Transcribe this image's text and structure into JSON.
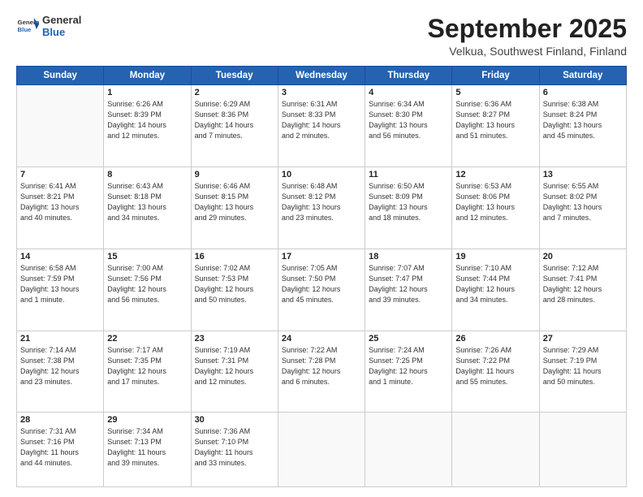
{
  "header": {
    "logo_general": "General",
    "logo_blue": "Blue",
    "month_title": "September 2025",
    "location": "Velkua, Southwest Finland, Finland"
  },
  "weekdays": [
    "Sunday",
    "Monday",
    "Tuesday",
    "Wednesday",
    "Thursday",
    "Friday",
    "Saturday"
  ],
  "weeks": [
    [
      {
        "day": "",
        "info": ""
      },
      {
        "day": "1",
        "info": "Sunrise: 6:26 AM\nSunset: 8:39 PM\nDaylight: 14 hours\nand 12 minutes."
      },
      {
        "day": "2",
        "info": "Sunrise: 6:29 AM\nSunset: 8:36 PM\nDaylight: 14 hours\nand 7 minutes."
      },
      {
        "day": "3",
        "info": "Sunrise: 6:31 AM\nSunset: 8:33 PM\nDaylight: 14 hours\nand 2 minutes."
      },
      {
        "day": "4",
        "info": "Sunrise: 6:34 AM\nSunset: 8:30 PM\nDaylight: 13 hours\nand 56 minutes."
      },
      {
        "day": "5",
        "info": "Sunrise: 6:36 AM\nSunset: 8:27 PM\nDaylight: 13 hours\nand 51 minutes."
      },
      {
        "day": "6",
        "info": "Sunrise: 6:38 AM\nSunset: 8:24 PM\nDaylight: 13 hours\nand 45 minutes."
      }
    ],
    [
      {
        "day": "7",
        "info": "Sunrise: 6:41 AM\nSunset: 8:21 PM\nDaylight: 13 hours\nand 40 minutes."
      },
      {
        "day": "8",
        "info": "Sunrise: 6:43 AM\nSunset: 8:18 PM\nDaylight: 13 hours\nand 34 minutes."
      },
      {
        "day": "9",
        "info": "Sunrise: 6:46 AM\nSunset: 8:15 PM\nDaylight: 13 hours\nand 29 minutes."
      },
      {
        "day": "10",
        "info": "Sunrise: 6:48 AM\nSunset: 8:12 PM\nDaylight: 13 hours\nand 23 minutes."
      },
      {
        "day": "11",
        "info": "Sunrise: 6:50 AM\nSunset: 8:09 PM\nDaylight: 13 hours\nand 18 minutes."
      },
      {
        "day": "12",
        "info": "Sunrise: 6:53 AM\nSunset: 8:06 PM\nDaylight: 13 hours\nand 12 minutes."
      },
      {
        "day": "13",
        "info": "Sunrise: 6:55 AM\nSunset: 8:02 PM\nDaylight: 13 hours\nand 7 minutes."
      }
    ],
    [
      {
        "day": "14",
        "info": "Sunrise: 6:58 AM\nSunset: 7:59 PM\nDaylight: 13 hours\nand 1 minute."
      },
      {
        "day": "15",
        "info": "Sunrise: 7:00 AM\nSunset: 7:56 PM\nDaylight: 12 hours\nand 56 minutes."
      },
      {
        "day": "16",
        "info": "Sunrise: 7:02 AM\nSunset: 7:53 PM\nDaylight: 12 hours\nand 50 minutes."
      },
      {
        "day": "17",
        "info": "Sunrise: 7:05 AM\nSunset: 7:50 PM\nDaylight: 12 hours\nand 45 minutes."
      },
      {
        "day": "18",
        "info": "Sunrise: 7:07 AM\nSunset: 7:47 PM\nDaylight: 12 hours\nand 39 minutes."
      },
      {
        "day": "19",
        "info": "Sunrise: 7:10 AM\nSunset: 7:44 PM\nDaylight: 12 hours\nand 34 minutes."
      },
      {
        "day": "20",
        "info": "Sunrise: 7:12 AM\nSunset: 7:41 PM\nDaylight: 12 hours\nand 28 minutes."
      }
    ],
    [
      {
        "day": "21",
        "info": "Sunrise: 7:14 AM\nSunset: 7:38 PM\nDaylight: 12 hours\nand 23 minutes."
      },
      {
        "day": "22",
        "info": "Sunrise: 7:17 AM\nSunset: 7:35 PM\nDaylight: 12 hours\nand 17 minutes."
      },
      {
        "day": "23",
        "info": "Sunrise: 7:19 AM\nSunset: 7:31 PM\nDaylight: 12 hours\nand 12 minutes."
      },
      {
        "day": "24",
        "info": "Sunrise: 7:22 AM\nSunset: 7:28 PM\nDaylight: 12 hours\nand 6 minutes."
      },
      {
        "day": "25",
        "info": "Sunrise: 7:24 AM\nSunset: 7:25 PM\nDaylight: 12 hours\nand 1 minute."
      },
      {
        "day": "26",
        "info": "Sunrise: 7:26 AM\nSunset: 7:22 PM\nDaylight: 11 hours\nand 55 minutes."
      },
      {
        "day": "27",
        "info": "Sunrise: 7:29 AM\nSunset: 7:19 PM\nDaylight: 11 hours\nand 50 minutes."
      }
    ],
    [
      {
        "day": "28",
        "info": "Sunrise: 7:31 AM\nSunset: 7:16 PM\nDaylight: 11 hours\nand 44 minutes."
      },
      {
        "day": "29",
        "info": "Sunrise: 7:34 AM\nSunset: 7:13 PM\nDaylight: 11 hours\nand 39 minutes."
      },
      {
        "day": "30",
        "info": "Sunrise: 7:36 AM\nSunset: 7:10 PM\nDaylight: 11 hours\nand 33 minutes."
      },
      {
        "day": "",
        "info": ""
      },
      {
        "day": "",
        "info": ""
      },
      {
        "day": "",
        "info": ""
      },
      {
        "day": "",
        "info": ""
      }
    ]
  ]
}
